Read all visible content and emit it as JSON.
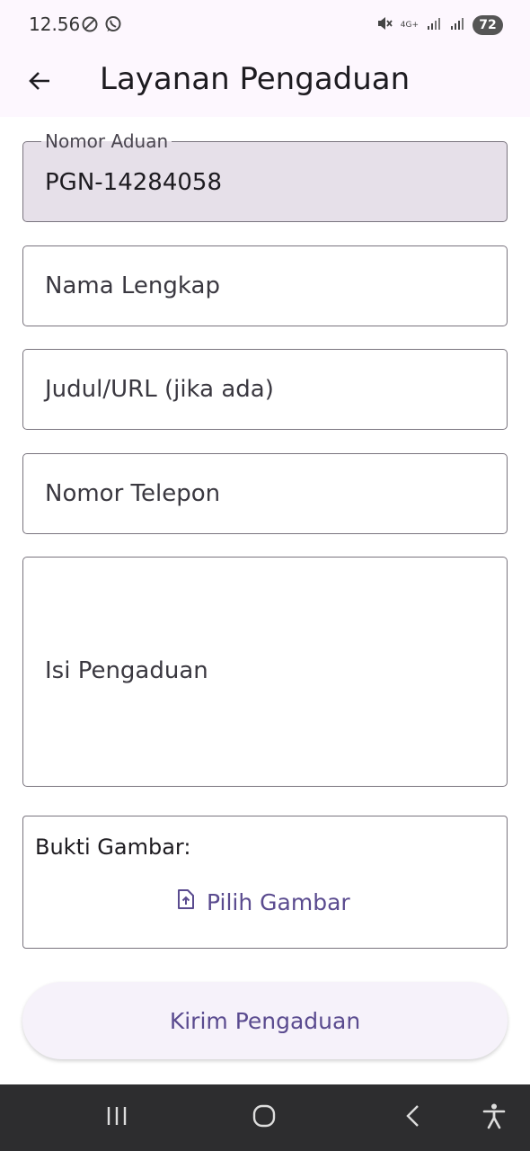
{
  "status_bar": {
    "time": "12.56",
    "network": "4G+",
    "battery": "72"
  },
  "app_bar": {
    "title": "Layanan Pengaduan"
  },
  "form": {
    "complaint_number": {
      "label": "Nomor Aduan",
      "value": "PGN-14284058"
    },
    "full_name": {
      "placeholder": "Nama Lengkap"
    },
    "title_url": {
      "placeholder": "Judul/URL (jika ada)"
    },
    "phone": {
      "placeholder": "Nomor Telepon"
    },
    "complaint_body": {
      "placeholder": "Isi Pengaduan"
    },
    "attachment": {
      "label": "Bukti Gambar:",
      "pick_label": "Pilih Gambar"
    },
    "submit_label": "Kirim Pengaduan"
  },
  "colors": {
    "accent": "#5a4b8f",
    "app_bar_bg": "#fdf7fe",
    "readonly_bg": "#e6e0e9",
    "nav_bar_bg": "#2d2d2f"
  },
  "icons": {
    "back": "arrow-left-icon",
    "pick_image": "file-upload-icon",
    "nav_recents": "recents-icon",
    "nav_home": "home-icon",
    "nav_back": "chevron-left-icon",
    "nav_accessibility": "accessibility-icon"
  }
}
